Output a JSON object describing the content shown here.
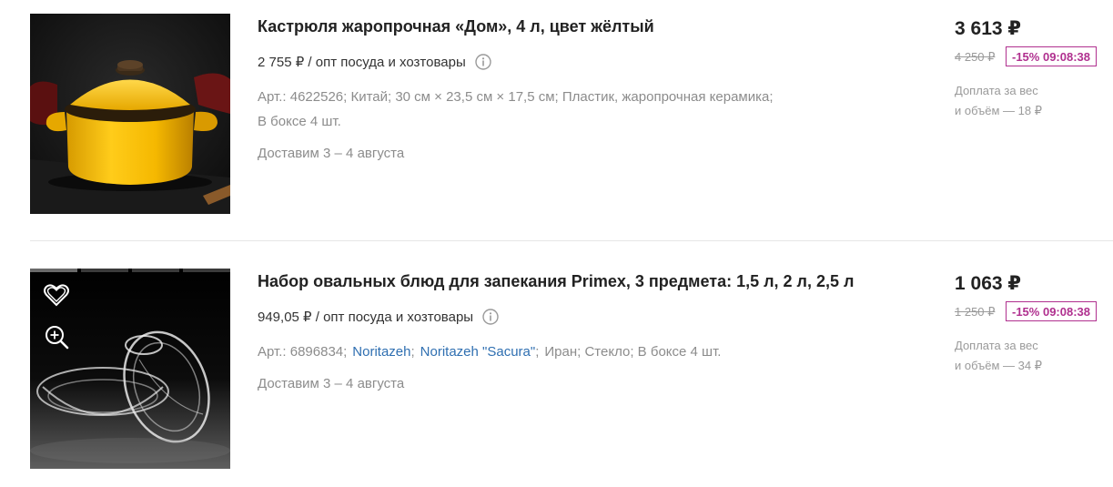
{
  "products": [
    {
      "title": "Кастрюля жаропрочная «Дом», 4 л, цвет жёлтый",
      "opt_price": "2 755 ₽ / опт посуда и хозтовары",
      "meta_line1": "Арт.: 4622526; Китай; 30 см × 23,5 см × 17,5 см; Пластик, жаропрочная керамика;",
      "meta_line2": "В боксе 4 шт.",
      "delivery": "Доставим 3 – 4 августа",
      "price": "3 613 ₽",
      "old_price": "4 250 ₽",
      "discount": "-15% 09:08:38",
      "surcharge_line1": "Доплата за вес",
      "surcharge_line2": "и объём — 18 ₽",
      "image_icon": "yellow-pot-image"
    },
    {
      "title": "Набор овальных блюд для запекания Primex, 3 предмета: 1,5 л, 2 л, 2,5 л",
      "opt_price": "949,05 ₽ / опт посуда и хозтовары",
      "meta_art": "Арт.: 6896834;",
      "meta_brand1": "Noritazeh",
      "meta_brand2": "Noritazeh \"Sacura\"",
      "meta_rest": "Иран; Стекло; В боксе 4 шт.",
      "delivery": "Доставим 3 – 4 августа",
      "price": "1 063 ₽",
      "old_price": "1 250 ₽",
      "discount": "-15% 09:08:38",
      "surcharge_line1": "Доплата за вес",
      "surcharge_line2": "и объём — 34 ₽",
      "image_icon": "glass-dishes-image"
    }
  ],
  "colors": {
    "discount": "#b0308f",
    "link": "#2f6fb1",
    "muted": "#8c8c8c"
  }
}
